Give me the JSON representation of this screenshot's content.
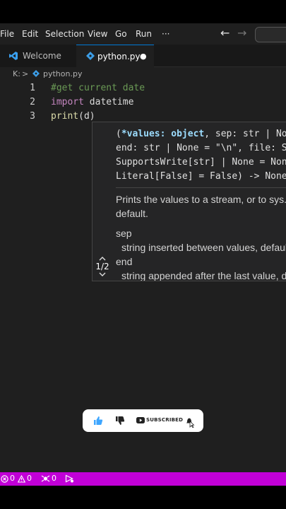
{
  "menu": {
    "items": [
      "File",
      "Edit",
      "Selection",
      "View",
      "Go",
      "Run"
    ],
    "more": "···",
    "back": "←",
    "forward": "→"
  },
  "tabs": [
    {
      "label": "Welcome",
      "icon": "vscode-icon"
    },
    {
      "label": "python.py",
      "icon": "python-icon",
      "modified_dot": "●"
    }
  ],
  "breadcrumb": {
    "drive": "K:",
    "sep": ">",
    "file": "python.py"
  },
  "editor": {
    "lines": [
      {
        "num": "1",
        "comment": "#get current date"
      },
      {
        "num": "2",
        "keyword": "import",
        "rest": " datetime"
      },
      {
        "num": "3",
        "fn": "print",
        "rest": "(d)"
      }
    ]
  },
  "hover": {
    "sig1_open": "(",
    "sig1_bold": "*values: object",
    "sig1_rest": ", sep: str | None = \" \",",
    "sig2": "end: str | None = \"\\n\", file: SupportsWrite[str] | None = None,",
    "sig3": "SupportsWrite[str] | None = None, flush:",
    "sig4": "Literal[False] = False) -> None",
    "doc1": "Prints the values to a stream, or to sys.stdout by",
    "doc2": "default.",
    "sep_title": "sep",
    "sep_desc": "string inserted between values, default a space.",
    "end_title": "end",
    "end_desc": "string appended after the last value, default a newline.",
    "overload": "1/2"
  },
  "subscribe": {
    "label": "SUBSCRIBED"
  },
  "status": {
    "errors": "0",
    "warnings": "0",
    "ports": "0"
  }
}
